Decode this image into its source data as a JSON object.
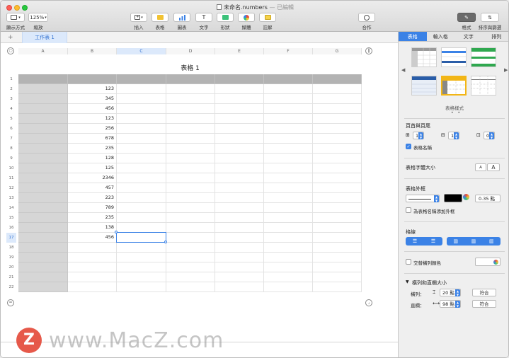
{
  "window": {
    "title": "未命名.numbers",
    "edited": " — 已編輯"
  },
  "toolbar": {
    "view_label": "顯示方式",
    "zoom_value": "125%",
    "zoom_label": "縮放",
    "insert_label": "插入",
    "table_label": "表格",
    "chart_label": "圖表",
    "text_label": "文字",
    "shape_label": "形狀",
    "media_label": "媒體",
    "comment_label": "註解",
    "collaborate_label": "合作",
    "format_label": "格式",
    "sort_label": "排序與篩選",
    "text_icon_glyph": "T"
  },
  "sheet": {
    "tab_label": "工作表 1",
    "add_glyph": "+"
  },
  "table": {
    "title": "表格 1",
    "columns": [
      "A",
      "B",
      "C",
      "D",
      "E",
      "F",
      "G"
    ],
    "selected_column": "C",
    "row_numbers": [
      "1",
      "2",
      "3",
      "4",
      "5",
      "6",
      "7",
      "8",
      "9",
      "10",
      "11",
      "12",
      "13",
      "14",
      "15",
      "16",
      "17",
      "18",
      "19",
      "20",
      "21",
      "22"
    ],
    "selected_row": "17",
    "col_b_values": [
      "",
      "123",
      "345",
      "456",
      "123",
      "256",
      "678",
      "235",
      "128",
      "125",
      "2346",
      "457",
      "223",
      "789",
      "235",
      "138",
      "456",
      "",
      "",
      "",
      "",
      ""
    ]
  },
  "inspector": {
    "tabs": [
      "表格",
      "輸入格",
      "文字",
      "排列"
    ],
    "active_tab": "表格",
    "styles_label": "表格樣式",
    "pager": "• •",
    "header_footer": {
      "title": "頁首與頁尾",
      "header_rows": "1",
      "header_cols": "1",
      "footer_rows": "0",
      "table_name_label": "表格名稱"
    },
    "font_size": {
      "title": "表格字體大小",
      "smaller": "A",
      "larger": "A"
    },
    "outline": {
      "title": "表格外框",
      "width": "0.35 點",
      "title_outline_label": "為表格名稱添加外框"
    },
    "gridlines": {
      "title": "格線"
    },
    "alternate": {
      "label": "交替橫列顏色"
    },
    "row_col_size": {
      "title": "橫列和直欄大小",
      "rows_label": "橫列：",
      "rows_value": "20 點",
      "cols_label": "直欄：",
      "cols_value": "98 點",
      "fit_label": "符合"
    }
  },
  "watermark": {
    "logo": "Z",
    "text": "www.MacZ.com"
  },
  "colors": {
    "accent": "#3b82e6",
    "header_fill": "#b3b3b3",
    "row_header_fill": "#d6d6d6",
    "selected_style": "#f2b616"
  }
}
